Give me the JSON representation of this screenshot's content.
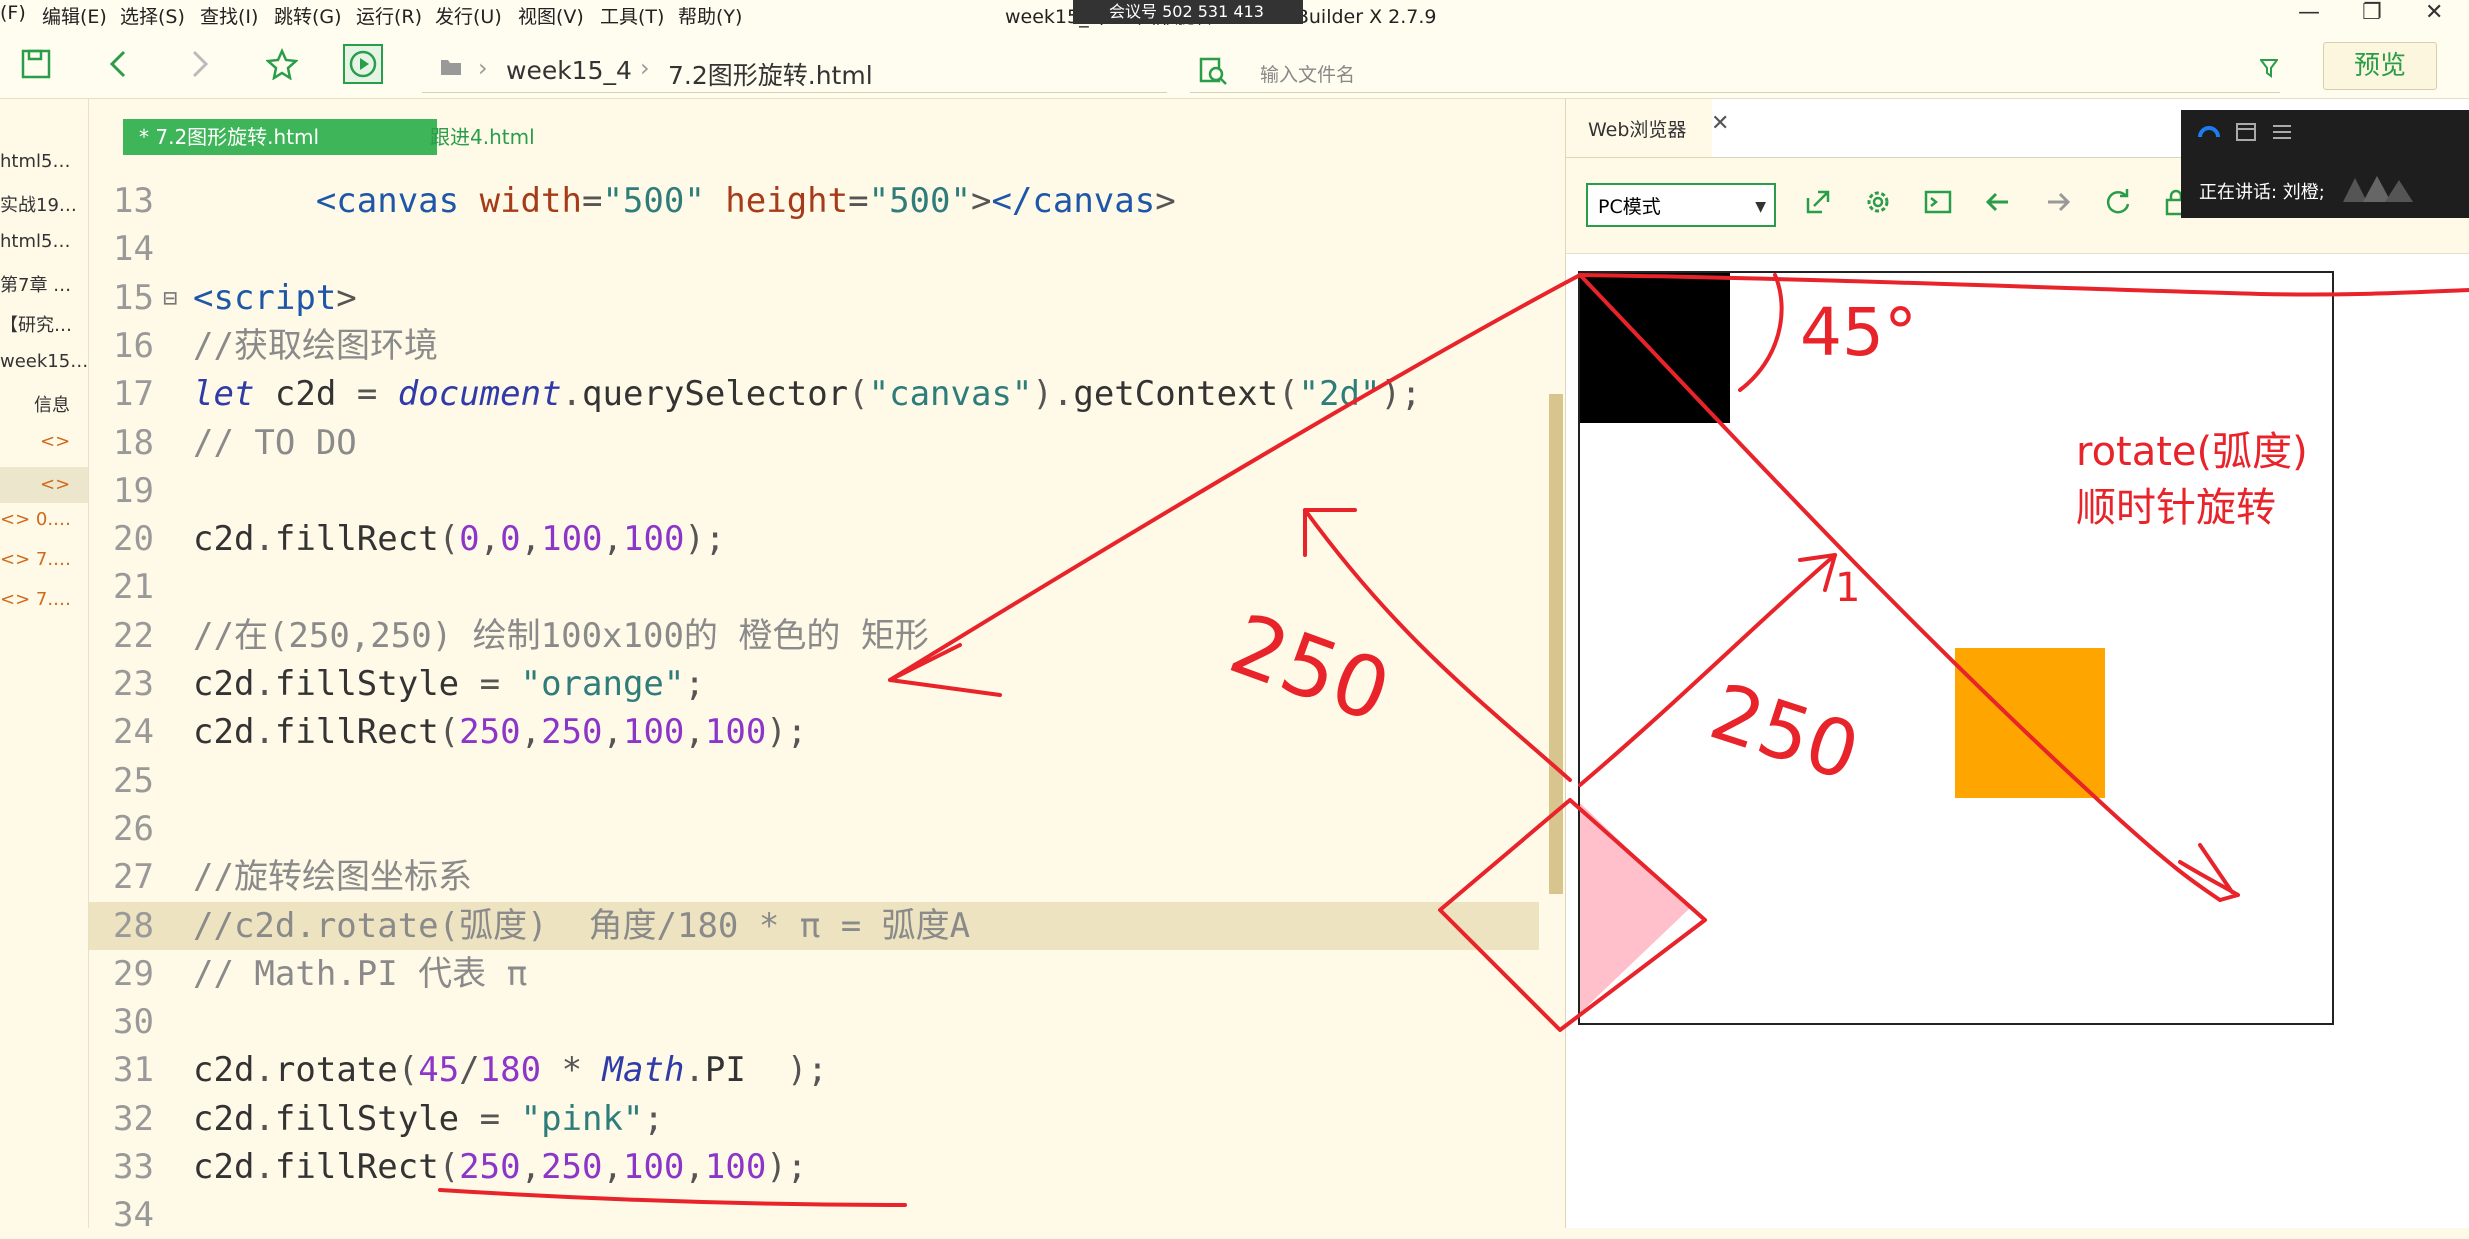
{
  "window": {
    "menu": [
      "(F)",
      "编辑(E)",
      "选择(S)",
      "查找(I)",
      "跳转(G)",
      "运行(R)",
      "发行(U)",
      "视图(V)",
      "工具(T)",
      "帮助(Y)"
    ],
    "title": "week15_4/7.2图形旋转.html - HBuilder X 2.7.9",
    "meeting_badge": "会议号 502 531 413",
    "controls": {
      "minimize": "—",
      "restore": "❐",
      "close": "✕"
    }
  },
  "toolbar": {
    "breadcrumb": [
      "week15_4",
      "7.2图形旋转.html"
    ],
    "search_placeholder": "输入文件名",
    "preview_label": "预览"
  },
  "file_tree": {
    "items": [
      "html5…",
      "实战19…",
      "html5…",
      "第7章 …",
      "【研究…",
      "week15…",
      "信息",
      "<>",
      "<>",
      "<> 0.…",
      "<> 7.…",
      "<> 7.…"
    ]
  },
  "editor": {
    "tabs": [
      "* 7.2图形旋转.html",
      "跟进4.html"
    ],
    "lines": [
      {
        "n": "13",
        "text": "      <canvas width=\"500\" height=\"500\"></canvas>"
      },
      {
        "n": "14",
        "text": ""
      },
      {
        "n": "15",
        "text": "<script>"
      },
      {
        "n": "16",
        "text": "//获取绘图环境"
      },
      {
        "n": "17",
        "text": "let c2d = document.querySelector(\"canvas\").getContext(\"2d\");"
      },
      {
        "n": "18",
        "text": "// TO DO"
      },
      {
        "n": "19",
        "text": ""
      },
      {
        "n": "20",
        "text": "c2d.fillRect(0,0,100,100);"
      },
      {
        "n": "21",
        "text": ""
      },
      {
        "n": "22",
        "text": "//在(250,250) 绘制100x100的 橙色的 矩形"
      },
      {
        "n": "23",
        "text": "c2d.fillStyle = \"orange\";"
      },
      {
        "n": "24",
        "text": "c2d.fillRect(250,250,100,100);"
      },
      {
        "n": "25",
        "text": ""
      },
      {
        "n": "26",
        "text": ""
      },
      {
        "n": "27",
        "text": "//旋转绘图坐标系"
      },
      {
        "n": "28",
        "text": "//c2d.rotate(弧度)  角度/180 * π = 弧度A"
      },
      {
        "n": "29",
        "text": "// Math.PI 代表 π"
      },
      {
        "n": "30",
        "text": ""
      },
      {
        "n": "31",
        "text": "c2d.rotate(45/180 * Math.PI  );"
      },
      {
        "n": "32",
        "text": "c2d.fillStyle = \"pink\";"
      },
      {
        "n": "33",
        "text": "c2d.fillRect(250,250,100,100);"
      },
      {
        "n": "34",
        "text": ""
      }
    ]
  },
  "browser": {
    "tab_label": "Web浏览器",
    "mode": "PC模式",
    "colors": {
      "rect1": "#000000",
      "rect2": "#ffa500",
      "rect3": "#ffc0cb"
    }
  },
  "meeting": {
    "speaking": "正在讲话: 刘橙;"
  },
  "annotations": {
    "angle": "45°",
    "dist1": "250",
    "dist2": "250",
    "note1": "rotate(弧度)",
    "note2": "顺时针旋转",
    "mark": "1"
  }
}
